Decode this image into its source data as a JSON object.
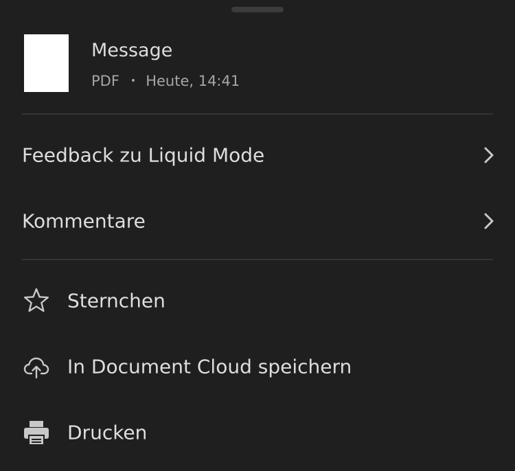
{
  "file": {
    "title": "Message",
    "type": "PDF",
    "separator": "•",
    "date": "Heute, 14:41"
  },
  "menu": {
    "feedback_label": "Feedback zu Liquid Mode",
    "comments_label": "Kommentare",
    "star_label": "Sternchen",
    "cloud_label": "In Document Cloud speichern",
    "print_label": "Drucken"
  },
  "icons": {
    "star": "star-icon",
    "cloud": "cloud-upload-icon",
    "print": "printer-icon",
    "chevron": "chevron-right-icon"
  },
  "colors": {
    "background": "#1f1f1f",
    "text": "#dedede",
    "secondary_text": "#a6a6a6",
    "divider": "#353535"
  }
}
